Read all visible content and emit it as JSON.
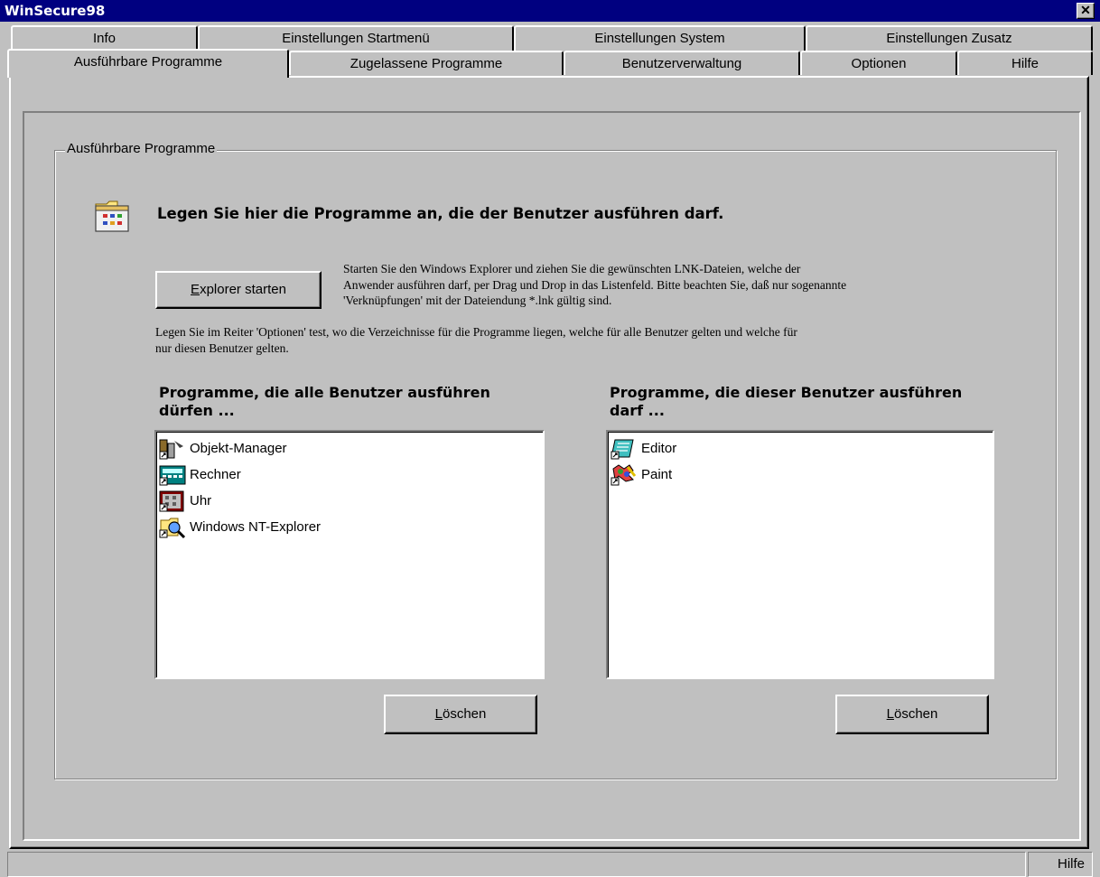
{
  "window": {
    "title": "WinSecure98",
    "close_glyph": "✕"
  },
  "tabs_row_back": [
    {
      "label": "Info"
    },
    {
      "label": "Einstellungen Startmenü"
    },
    {
      "label": "Einstellungen System"
    },
    {
      "label": "Einstellungen Zusatz"
    }
  ],
  "tabs_row_front": [
    {
      "label": "Ausführbare Programme",
      "active": true
    },
    {
      "label": "Zugelassene Programme"
    },
    {
      "label": "Benutzerverwaltung"
    },
    {
      "label": "Optionen"
    },
    {
      "label": "Hilfe"
    }
  ],
  "group": {
    "label": "Ausführbare Programme",
    "icon": "programs-folder-icon",
    "headline": "Legen Sie hier die Programme an, die der Benutzer ausführen darf.",
    "explorer_button": {
      "accel": "E",
      "rest": "xplorer starten"
    },
    "desc_lines": [
      "Starten Sie den Windows Explorer und ziehen Sie die gewünschten LNK-Dateien, welche der",
      "Anwender ausführen darf, per Drag und Drop in das Listenfeld. Bitte beachten Sie, daß nur sogenannte",
      "'Verknüpfungen' mit der Dateiendung *.lnk gültig sind."
    ],
    "note_lines": [
      "Legen Sie im Reiter 'Optionen' test, wo die Verzeichnisse für die Programme liegen, welche für alle Benutzer gelten und welche für",
      "nur diesen Benutzer gelten."
    ]
  },
  "lists": {
    "all_users": {
      "heading_lines": [
        "Programme, die alle Benutzer ausführen",
        "dürfen ..."
      ],
      "items": [
        {
          "label": "Objekt-Manager",
          "icon": "object-manager-icon"
        },
        {
          "label": "Rechner",
          "icon": "calculator-icon"
        },
        {
          "label": "Uhr",
          "icon": "clock-icon"
        },
        {
          "label": "Windows NT-Explorer",
          "icon": "explorer-icon"
        }
      ],
      "delete_button": {
        "accel": "L",
        "rest": "öschen"
      }
    },
    "this_user": {
      "heading_lines": [
        "Programme, die dieser Benutzer ausführen",
        "darf ..."
      ],
      "items": [
        {
          "label": "Editor",
          "icon": "notepad-icon"
        },
        {
          "label": "Paint",
          "icon": "paint-icon"
        }
      ],
      "delete_button": {
        "accel": "L",
        "rest": "öschen"
      }
    }
  },
  "statusbar": {
    "help_label": "Hilfe"
  }
}
